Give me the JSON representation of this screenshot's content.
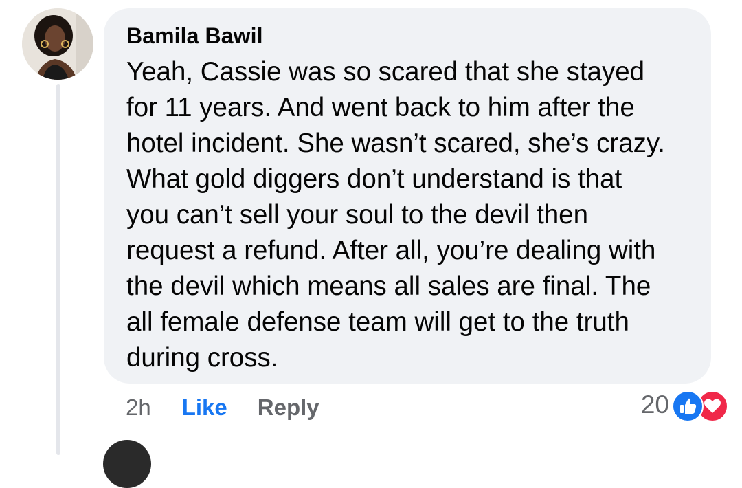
{
  "comment": {
    "author": "Bamila Bawil",
    "text": "Yeah, Cassie was so scared that she stayed\nfor 11 years. And went back to him after the\nhotel incident. She wasn’t scared, she’s crazy.\nWhat gold diggers don’t understand is that\nyou can’t sell your soul to the devil then\nrequest a refund. After all, you’re dealing with\nthe devil which means all sales are final. The\nall female defense team will get to the truth\nduring cross.",
    "timestamp": "2h",
    "like_label": "Like",
    "reply_label": "Reply",
    "reaction_count": "20",
    "reaction_icons": [
      "thumbs-up-icon",
      "heart-icon"
    ]
  },
  "colors": {
    "bubble": "#f0f2f5",
    "like_blue": "#1877f2",
    "love_red": "#f02849",
    "secondary_text": "#65676b"
  }
}
